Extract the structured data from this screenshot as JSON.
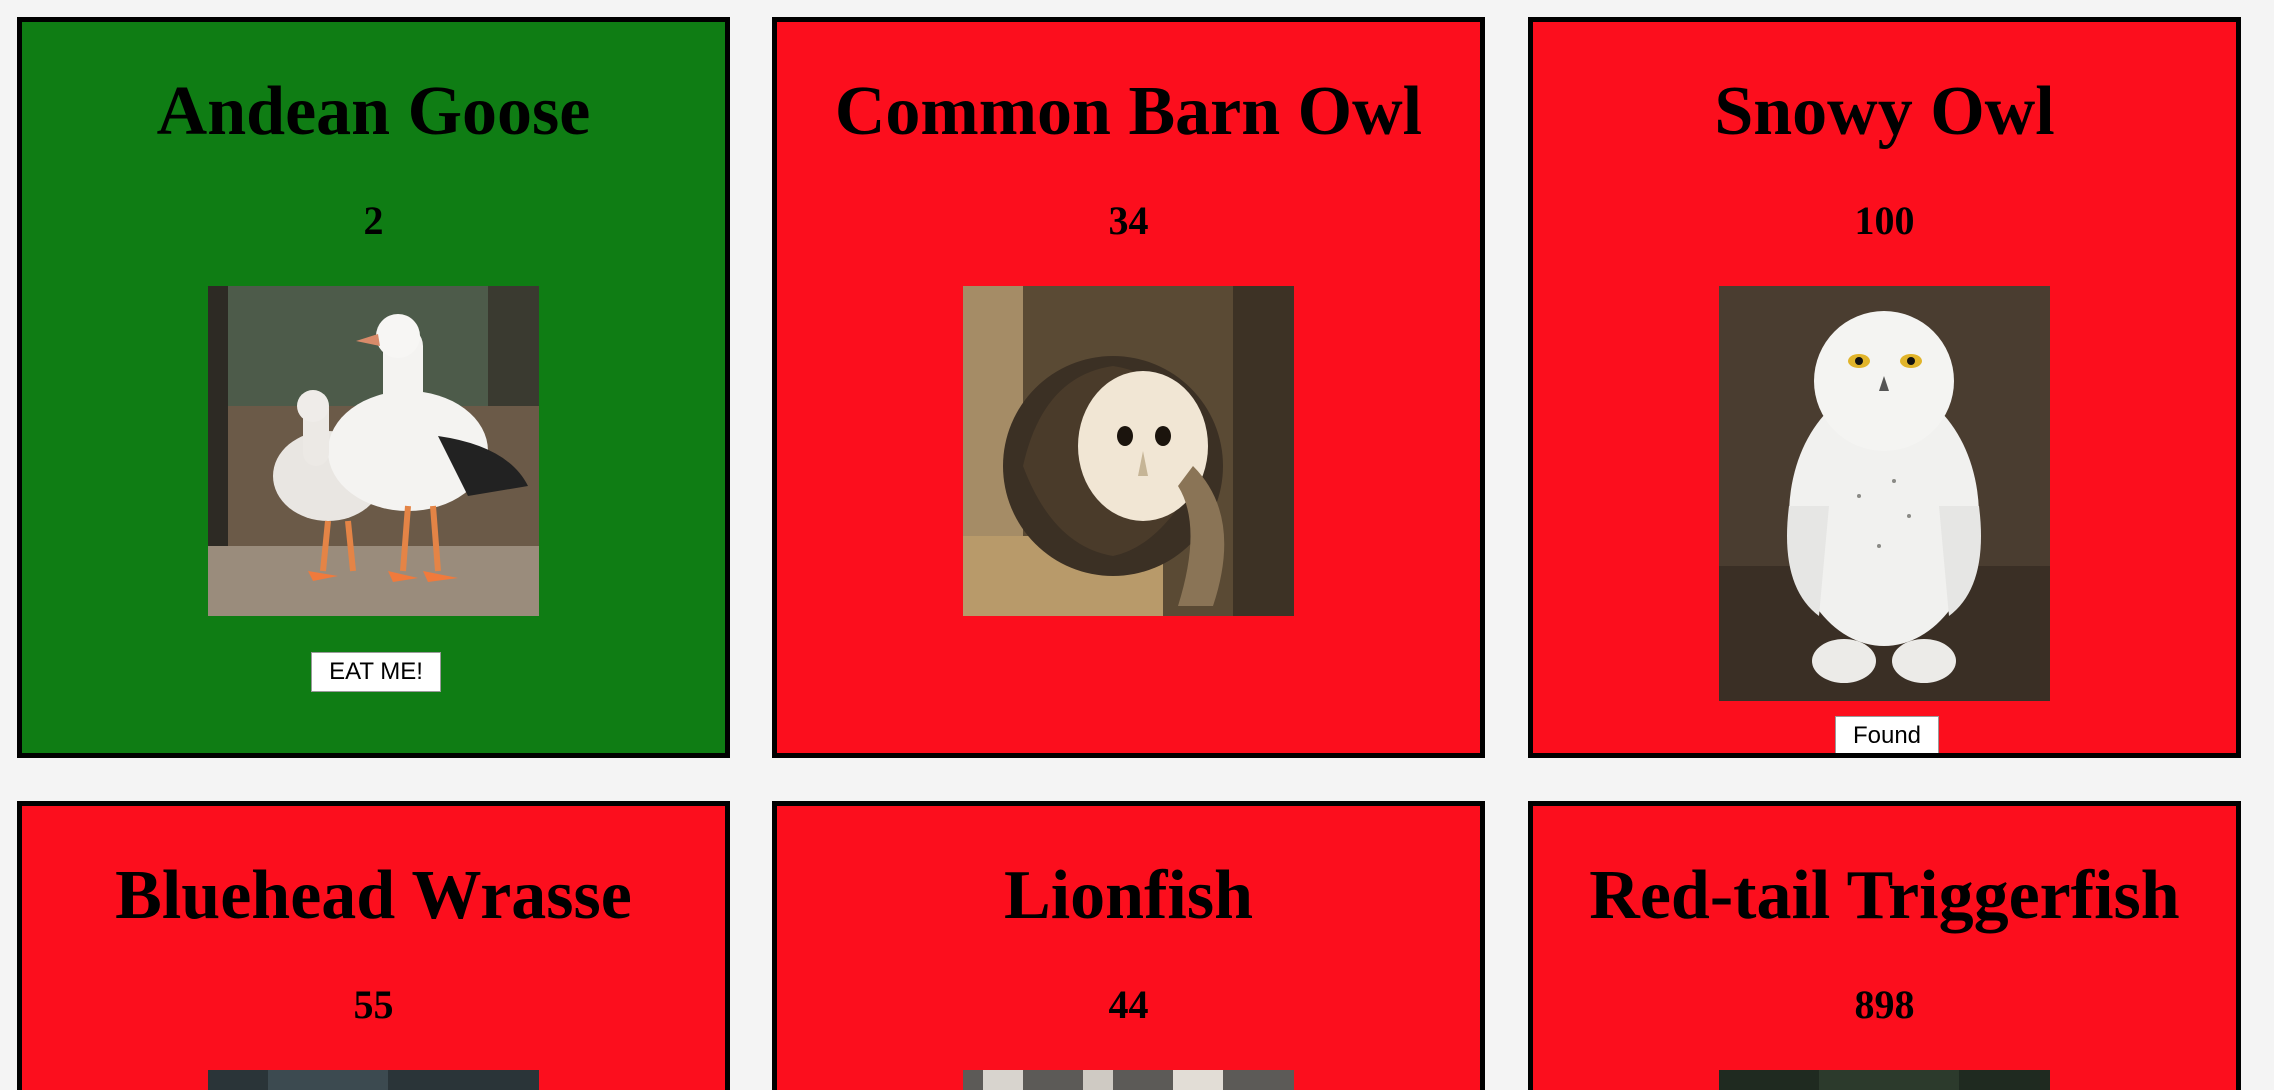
{
  "colors": {
    "fed": "#0f7d14",
    "hungry": "#fc0e1d",
    "border": "#000000",
    "page_background": "#f4f4f4"
  },
  "animals": [
    {
      "name": "Andean Goose",
      "count": "2",
      "status": "fed",
      "button": "EAT ME!",
      "photo": "andean-goose-photo"
    },
    {
      "name": "Common Barn Owl",
      "count": "34",
      "status": "hungry",
      "button": "",
      "photo": "barn-owl-photo"
    },
    {
      "name": "Snowy Owl",
      "count": "100",
      "status": "hungry",
      "button": "Found",
      "photo": "snowy-owl-photo"
    },
    {
      "name": "Bluehead Wrasse",
      "count": "55",
      "status": "hungry",
      "button": "",
      "photo": "bluehead-wrasse-photo"
    },
    {
      "name": "Lionfish",
      "count": "44",
      "status": "hungry",
      "button": "",
      "photo": "lionfish-photo"
    },
    {
      "name": "Red-tail Triggerfish",
      "count": "898",
      "status": "hungry",
      "button": "",
      "photo": "red-tail-triggerfish-photo"
    }
  ]
}
